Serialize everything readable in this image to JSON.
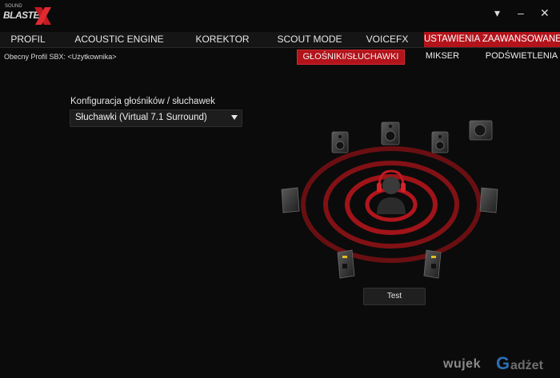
{
  "window": {
    "logo_small": "SOUND",
    "logo_brand": "BLASTER",
    "min_glyph": "▾",
    "max_glyph": "–",
    "close_glyph": "✕"
  },
  "menu": {
    "tabs": [
      {
        "label": "PROFIL",
        "active": false
      },
      {
        "label": "ACOUSTIC ENGINE",
        "active": false
      },
      {
        "label": "KOREKTOR",
        "active": false
      },
      {
        "label": "SCOUT MODE",
        "active": false
      },
      {
        "label": "VOICEFX",
        "active": false
      },
      {
        "label": "USTAWIENIA ZAAWANSOWANE",
        "active": true
      }
    ]
  },
  "profile": {
    "text": "Obecny Profil SBX: <Użytkownika>"
  },
  "subtabs": [
    {
      "label": "GŁOŚNIKI/SŁUCHAWKI",
      "active": true
    },
    {
      "label": "MIKSER",
      "active": false
    },
    {
      "label": "PODŚWIETLENIA",
      "active": false
    }
  ],
  "config": {
    "label": "Konfiguracja głośników / słuchawek",
    "selected": "Słuchawki (Virtual 7.1 Surround)"
  },
  "test_button": "Test",
  "watermark": {
    "part1": "wujek",
    "part2": "G",
    "part3": "adżet"
  },
  "colors": {
    "accent": "#b3131b",
    "background": "#0b0b0b",
    "ring": "#8e1216"
  }
}
